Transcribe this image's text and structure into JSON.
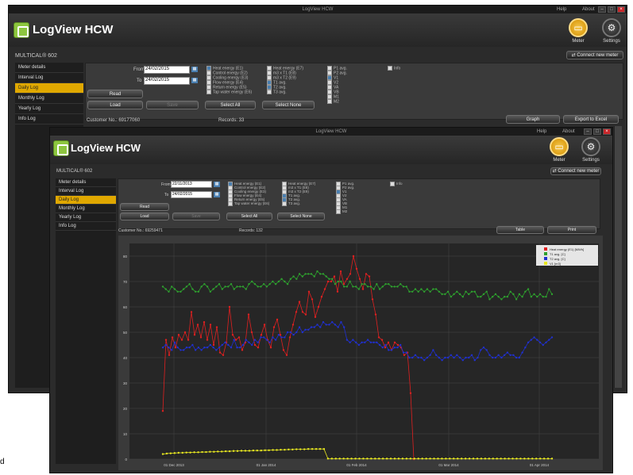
{
  "app": {
    "window_title": "LogView HCW",
    "help": "Help",
    "about": "About",
    "title": "LogView HCW",
    "meter_label": "Meter",
    "settings_label": "Settings",
    "connect_label": "Connect new meter"
  },
  "windows": [
    {
      "meter_name": "MULTICAL® 602",
      "sidebar": [
        "Meter details",
        "Interval Log",
        "Daily Log",
        "Monthly Log",
        "Yearly Log",
        "Info Log"
      ],
      "active": 2,
      "from_label": "From",
      "from": "24/02/2015",
      "to_label": "To",
      "to": "24/02/2015",
      "read": "Read",
      "load": "Load",
      "save": "Save",
      "select_all": "Select All",
      "select_none": "Select None",
      "customer": "Customer No.: 69177060",
      "records": "Records: 33",
      "graph_btn": "Graph",
      "export_btn": "Export to Excel"
    },
    {
      "meter_name": "MULTICAL® 602",
      "sidebar": [
        "Meter details",
        "Interval Log",
        "Daily Log",
        "Monthly Log",
        "Yearly Log",
        "Info Log"
      ],
      "active": 2,
      "from_label": "From",
      "from": "22/11/2013",
      "to_label": "To",
      "to": "24/02/2015",
      "read": "Read",
      "load": "Load",
      "save": "Save",
      "select_all": "Select All",
      "select_none": "Select None",
      "customer": "Customer No.: 69259471",
      "records": "Records: 132",
      "graph_btn": "Table",
      "export_btn": "Print"
    }
  ],
  "checkboxes": {
    "col1": [
      [
        "Heat energy (E1)",
        1
      ],
      [
        "Control energy (E2)",
        0
      ],
      [
        "Cooling energy (E3)",
        0
      ],
      [
        "Flow energy (E4)",
        0
      ],
      [
        "Return energy (E5)",
        0
      ],
      [
        "Tap water energy (E6)",
        0
      ]
    ],
    "col2": [
      [
        "Heat energy (E7)",
        0
      ],
      [
        "m3 x T1 (E8)",
        0
      ],
      [
        "m3 x T2 (E9)",
        0
      ],
      [
        "T1 avg.",
        1
      ],
      [
        "T2 avg.",
        1
      ],
      [
        "T3 avg.",
        0
      ]
    ],
    "col3": [
      [
        "P1 avg.",
        0
      ],
      [
        "P2 avg.",
        0
      ],
      [
        "V1",
        1
      ],
      [
        "V2",
        0
      ],
      [
        "VA",
        0
      ],
      [
        "VB",
        0
      ],
      [
        "M1",
        0
      ],
      [
        "M2",
        0
      ]
    ],
    "col4": [
      [
        "Info",
        0
      ]
    ]
  },
  "chart_data": {
    "type": "line",
    "x_ticks": [
      "01 Dec 2013",
      "01 Jan 2014",
      "01 Feb 2014",
      "01 Mar 2014",
      "01 Apr 2014"
    ],
    "y_ticks": [
      0,
      10,
      20,
      30,
      40,
      50,
      60,
      70,
      80
    ],
    "ylim": [
      0,
      85
    ],
    "legend": [
      "Heat energy (E1) [MWh]",
      "T1 avg. [C]",
      "T2 avg. [C]",
      "V1 [m3]"
    ],
    "legend_position": "top-right",
    "grid": true,
    "series": [
      {
        "name": "Heat energy (E1) [MWh]",
        "color": "#e02020",
        "values": [
          19,
          47,
          41,
          48,
          44,
          49,
          47,
          50,
          47,
          58,
          49,
          53,
          48,
          54,
          47,
          53,
          45,
          52,
          42,
          41,
          46,
          60,
          49,
          47,
          48,
          43,
          46,
          57,
          50,
          45,
          44,
          49,
          53,
          47,
          44,
          52,
          55,
          49,
          43,
          41,
          48,
          53,
          58,
          62,
          58,
          57,
          66,
          63,
          56,
          60,
          64,
          67,
          70,
          70,
          72,
          66,
          74,
          69,
          71,
          73,
          80,
          75,
          71,
          67,
          73,
          72,
          63,
          57,
          48,
          47,
          44,
          46,
          43,
          46,
          45,
          44,
          41,
          42,
          26,
          0
        ]
      },
      {
        "name": "T1 avg. [C]",
        "color": "#2ea02e",
        "values": [
          68,
          67,
          66,
          68,
          67,
          66,
          66,
          67,
          68,
          69,
          67,
          66,
          66,
          68,
          69,
          68,
          66,
          67,
          68,
          69,
          67,
          68,
          68,
          69,
          67,
          68,
          68,
          68,
          67,
          69,
          70,
          69,
          68,
          68,
          69,
          68,
          69,
          70,
          69,
          70,
          71,
          70,
          69,
          71,
          72,
          71,
          73,
          72,
          73,
          73,
          73,
          72,
          74,
          73,
          73,
          72,
          71,
          71,
          69,
          70,
          70,
          68,
          68,
          70,
          68,
          68,
          67,
          69,
          69,
          68,
          68,
          67,
          69,
          67,
          68,
          69,
          69,
          68,
          68,
          68,
          69,
          68,
          68,
          66,
          66,
          67,
          66,
          67,
          66,
          67,
          66,
          67,
          67,
          66,
          65,
          65,
          66,
          64,
          65,
          66,
          65,
          64,
          66,
          65,
          66,
          66,
          64,
          64,
          65,
          66,
          63,
          64,
          65,
          64,
          63,
          64,
          64,
          66,
          65,
          63,
          65,
          64,
          66,
          67,
          64,
          65,
          64,
          65,
          64,
          64,
          67,
          65
        ]
      },
      {
        "name": "T2 avg. [C]",
        "color": "#2030d0",
        "values": [
          44,
          45,
          44,
          43,
          46,
          44,
          43,
          43,
          44,
          44,
          45,
          43,
          44,
          43,
          44,
          44,
          45,
          44,
          43,
          44,
          45,
          46,
          45,
          44,
          47,
          44,
          44,
          45,
          47,
          46,
          45,
          47,
          46,
          48,
          48,
          47,
          46,
          48,
          47,
          49,
          48,
          48,
          50,
          50,
          49,
          50,
          52,
          50,
          51,
          51,
          52,
          52,
          53,
          52,
          54,
          53,
          53,
          54,
          53,
          52,
          54,
          52,
          47,
          46,
          47,
          46,
          45,
          46,
          46,
          47,
          46,
          46,
          46,
          45,
          44,
          45,
          43,
          43,
          44,
          44,
          45,
          42,
          42,
          40,
          40,
          41,
          40,
          40,
          39,
          40,
          41,
          43,
          41,
          40,
          39,
          40,
          40,
          41,
          40,
          41,
          40,
          39,
          40,
          40,
          41,
          39,
          40,
          43,
          44,
          43,
          41,
          40,
          40,
          41,
          40,
          41,
          42,
          41,
          41,
          40,
          40,
          42,
          44,
          46,
          47,
          48,
          47,
          46,
          45,
          46,
          47,
          48
        ]
      },
      {
        "name": "V1 [m3]",
        "color": "#e8e820",
        "values": [
          2,
          2.2,
          2.3,
          2.4,
          2.5,
          2.5,
          2.6,
          2.6,
          2.7,
          2.7,
          2.8,
          2.8,
          2.9,
          2.9,
          3,
          3,
          3.1,
          3.1,
          3.2,
          3.2,
          3.3,
          3.3,
          3.3,
          3.4,
          3.4,
          3.4,
          3.5,
          3.5,
          3.6,
          3.6,
          3.7,
          3.7,
          3.8,
          3.8,
          3.9,
          3.9,
          3.9,
          4,
          4,
          4,
          4,
          4,
          0.2,
          0.2,
          0.2,
          0.2,
          0.2,
          0.2,
          0.2,
          0.2,
          0.2,
          0.2,
          0.2,
          0.2,
          0.2,
          0.2,
          0.2,
          0.2,
          0.2,
          0.2,
          0.2,
          0.2,
          0.2,
          0.2,
          0.2,
          0.2,
          0.2,
          0.2,
          0.2,
          0.2,
          0.2,
          0.2,
          0.2,
          0.2,
          0.2,
          0.2,
          0.2,
          0.2,
          0.2,
          0.2,
          0.2,
          0.2,
          0.2,
          0.2,
          0.2,
          0.2,
          0.2,
          0.2,
          0.2,
          0.2,
          0.2,
          0.2,
          0.2,
          0.2,
          0.2,
          0.2,
          0.2,
          0.2,
          0.2,
          0.2
        ]
      }
    ]
  },
  "stray_char": "d"
}
